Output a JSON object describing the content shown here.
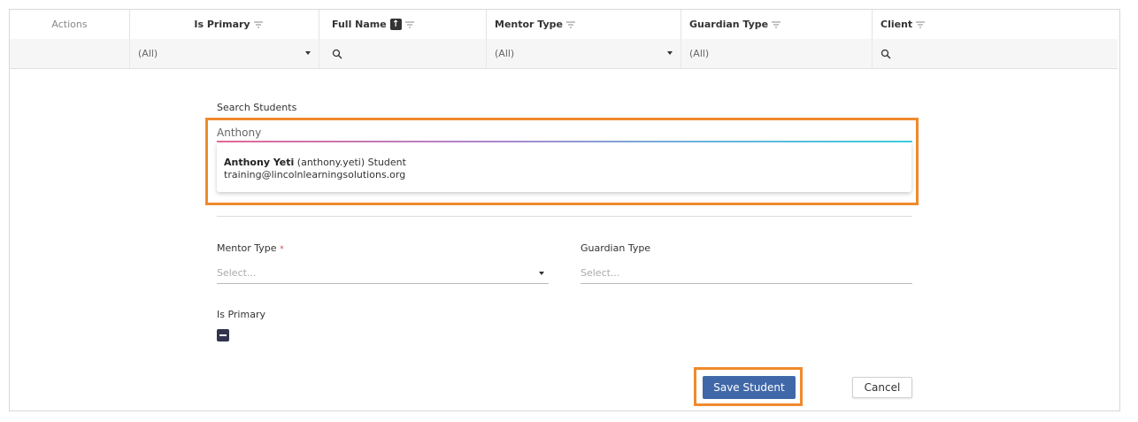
{
  "grid": {
    "columns": [
      {
        "label": "Actions"
      },
      {
        "label": "Is Primary"
      },
      {
        "label": "Full Name",
        "sort": "↑"
      },
      {
        "label": "Mentor Type"
      },
      {
        "label": "Guardian Type"
      },
      {
        "label": "Client"
      }
    ],
    "filters": {
      "is_primary": "(All)",
      "mentor_type": "(All)",
      "guardian_type": "(All)"
    }
  },
  "form": {
    "search_label": "Search Students",
    "search_value": "Anthony",
    "result": {
      "name": "Anthony Yeti",
      "username": "(anthony.yeti) Student",
      "email": "training@lincolnlearningsolutions.org"
    },
    "mentor_type_label": "Mentor Type",
    "required_mark": "*",
    "mentor_type_placeholder": "Select...",
    "guardian_type_label": "Guardian Type",
    "guardian_type_placeholder": "Select...",
    "is_primary_label": "Is Primary"
  },
  "buttons": {
    "save": "Save Student",
    "cancel": "Cancel"
  },
  "colors": {
    "highlight": "#ef8a2c",
    "primary": "#4068a8"
  }
}
